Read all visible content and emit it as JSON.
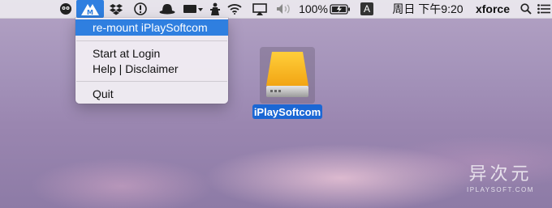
{
  "menubar": {
    "battery_percent": "100%",
    "input_method": "A",
    "datetime": "周日 下午9:20",
    "username": "xforce"
  },
  "dropdown": {
    "items": [
      {
        "label": "re-mount iPlaySoftcom",
        "highlighted": true
      },
      {
        "label": "Start at Login"
      },
      {
        "label": "Help | Disclaimer"
      },
      {
        "label": "Quit"
      }
    ]
  },
  "desktop": {
    "drive_label": "iPlaySoftcom",
    "watermark_cn": "异次元",
    "watermark_en": "IPLAYSOFT.COM"
  },
  "icons": [
    "owl-icon",
    "mounty-app-icon",
    "dropbox-icon",
    "alert-icon",
    "hat-icon",
    "window-manager-icon",
    "figure-icon",
    "wifi-icon",
    "airplay-icon",
    "volume-icon",
    "battery-icon",
    "input-method-icon",
    "search-icon",
    "list-icon"
  ],
  "colors": {
    "highlight": "#2f7fe0",
    "selection": "#1b67d4",
    "drive_body": "#f5b51c"
  }
}
